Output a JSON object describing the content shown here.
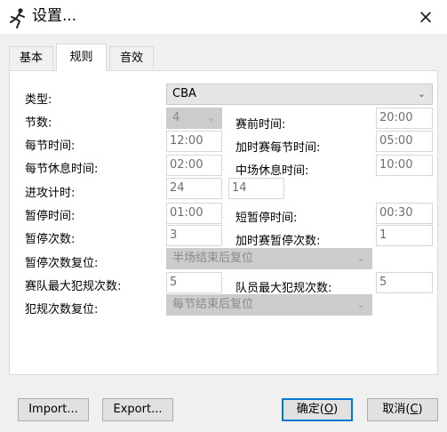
{
  "window": {
    "title": "设置...",
    "close": "×"
  },
  "tabs": [
    {
      "label": "基本",
      "active": false
    },
    {
      "label": "规则",
      "active": true
    },
    {
      "label": "音效",
      "active": false
    }
  ],
  "rules": {
    "type": {
      "label": "类型:",
      "value": "CBA"
    },
    "periods": {
      "label": "节数:",
      "value": "4"
    },
    "pregame_time": {
      "label": "赛前时间:",
      "value": "20:00"
    },
    "period_time": {
      "label": "每节时间:",
      "value": "12:00"
    },
    "overtime_period_time": {
      "label": "加时赛每节时间:",
      "value": "05:00"
    },
    "period_break_time": {
      "label": "每节休息时间:",
      "value": "02:00"
    },
    "halftime_break": {
      "label": "中场休息时间:",
      "value": "10:00"
    },
    "shot_clock": {
      "label": "进攻计时:",
      "value": "24",
      "value2": "14"
    },
    "timeout_time": {
      "label": "暂停时间:",
      "value": "01:00"
    },
    "short_timeout_time": {
      "label": "短暂停时间:",
      "value": "00:30"
    },
    "timeout_count": {
      "label": "暂停次数:",
      "value": "3"
    },
    "overtime_timeout_count": {
      "label": "加时赛暂停次数:",
      "value": "1"
    },
    "timeout_reset": {
      "label": "暂停次数复位:",
      "value": "半场结束后复位"
    },
    "team_foul_max": {
      "label": "赛队最大犯规次数:",
      "value": "5"
    },
    "player_foul_max": {
      "label": "队员最大犯规次数:",
      "value": "5"
    },
    "foul_reset": {
      "label": "犯规次数复位:",
      "value": "每节结束后复位"
    }
  },
  "buttons": {
    "import": "Import...",
    "export": "Export...",
    "ok_text": "确定(",
    "ok_key": "O",
    "ok_tail": ")",
    "cancel_text": "取消(",
    "cancel_key": "C",
    "cancel_tail": ")"
  },
  "icons": {
    "app": "basketball-player-icon",
    "chevron": "chevron-down-icon",
    "close": "close-icon"
  }
}
